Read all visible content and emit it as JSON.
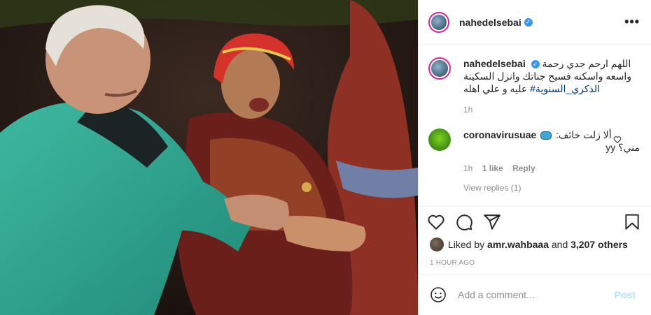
{
  "post": {
    "username": "nahedelsebai",
    "more_label": "•••"
  },
  "caption": {
    "username": "nahedelsebai",
    "text": "اللهم ارحم جدي رحمة واسعه واسكنه فسيح جناتك وانزل السكينة عليه و علي اهله",
    "hashtag": "#الذكري_السنوية",
    "time": "1h"
  },
  "comment": {
    "username": "coronavirusuae",
    "text": "ألا زلت خائف:",
    "text2": "مني؟ yy",
    "time": "1h",
    "likes": "1 like",
    "reply": "Reply",
    "view_replies": "View replies (1)"
  },
  "likes": {
    "prefix": "Liked by",
    "user": "amr.wahbaaa",
    "and": "and",
    "others": "3,207 others"
  },
  "timestamp": "1 HOUR AGO",
  "add_comment": {
    "placeholder": "Add a comment...",
    "post_label": "Post"
  },
  "colors": {
    "verified": "#3897f0",
    "link": "#00376b",
    "post_button": "#b2dffc",
    "meta_text": "#8e8e8e"
  },
  "icons": [
    "heart-icon",
    "comment-icon",
    "share-icon",
    "bookmark-icon",
    "emoji-icon",
    "verified-icon",
    "more-icon"
  ]
}
